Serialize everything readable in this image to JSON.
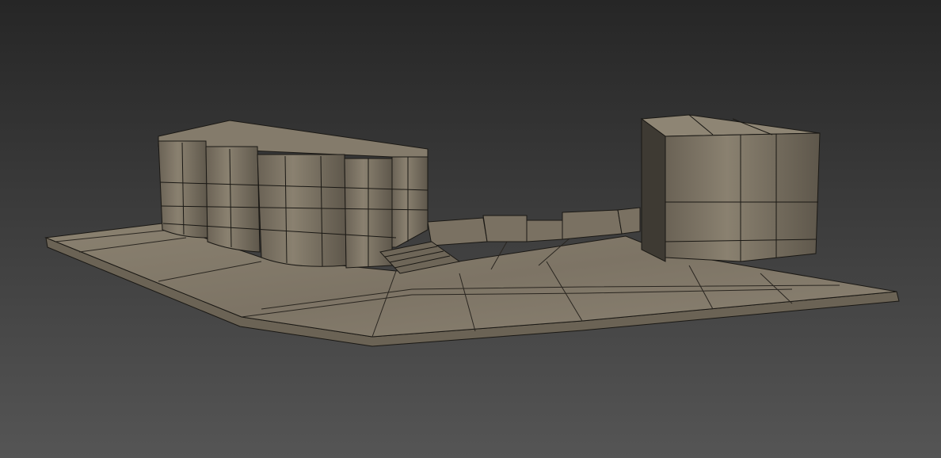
{
  "viewport": {
    "kind": "3d-viewport-render",
    "colors": {
      "background_top": "#262626",
      "background_bottom": "#555555",
      "stone_light": "#8a8170",
      "stone_mid": "#746b5c",
      "stone_dark": "#5a5347",
      "wire": "#1a1814"
    }
  }
}
